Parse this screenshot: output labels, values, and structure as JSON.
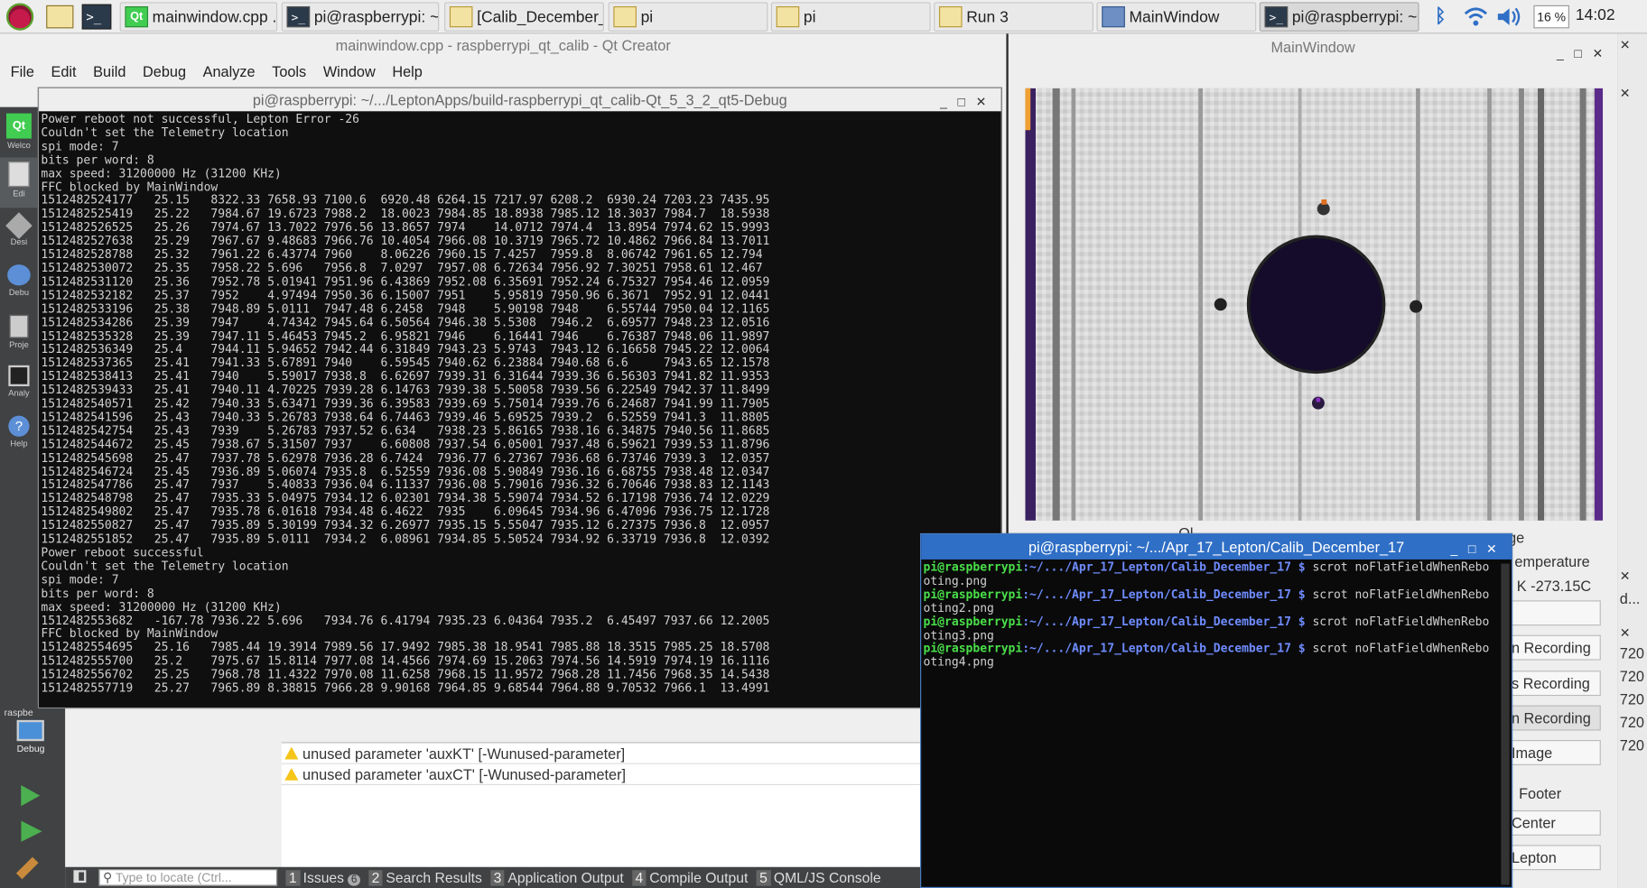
{
  "taskbar": {
    "tasks": [
      {
        "label": "mainwindow.cpp ...",
        "icon": "qt-creator-icon"
      },
      {
        "label": "pi@raspberrypi: ~...",
        "icon": "terminal-icon"
      },
      {
        "label": "[Calib_December_...",
        "icon": "folder-icon"
      },
      {
        "label": "pi",
        "icon": "folder-icon"
      },
      {
        "label": "pi",
        "icon": "folder-icon"
      },
      {
        "label": "Run 3",
        "icon": "folder-icon"
      },
      {
        "label": "MainWindow",
        "icon": "window-icon"
      },
      {
        "label": "pi@raspberrypi: ~...",
        "icon": "terminal-icon"
      }
    ],
    "cpu": "16 %",
    "clock": "14:02"
  },
  "qtcreator": {
    "title": "mainwindow.cpp - raspberrypi_qt_calib - Qt Creator",
    "menu": [
      "File",
      "Edit",
      "Build",
      "Debug",
      "Analyze",
      "Tools",
      "Window",
      "Help"
    ],
    "modes": [
      "Welco",
      "Edi",
      "Desi",
      "Debu",
      "Proje",
      "Analy",
      "Help"
    ],
    "kit": "raspbe",
    "kit_mode": "Debug",
    "issues": [
      "unused parameter 'auxKT' [-Wunused-parameter]",
      "unused parameter 'auxCT' [-Wunused-parameter]"
    ],
    "locate_placeholder": "Type to locate (Ctrl...",
    "output_tabs": [
      {
        "num": "1",
        "label": "Issues",
        "badge": "6"
      },
      {
        "num": "2",
        "label": "Search Results"
      },
      {
        "num": "3",
        "label": "Application Output"
      },
      {
        "num": "4",
        "label": "Compile Output"
      },
      {
        "num": "5",
        "label": "QML/JS Console"
      }
    ]
  },
  "term1": {
    "title": "pi@raspberrypi: ~/.../LeptonApps/build-raspberrypi_qt_calib-Qt_5_3_2_qt5-Debug",
    "lines": [
      "Power reboot not successful, Lepton Error -26",
      "Couldn't set the Telemetry location",
      "spi mode: 7",
      "bits per word: 8",
      "max speed: 31200000 Hz (31200 KHz)",
      "FFC blocked by MainWindow",
      "1512482524177   25.15   8322.33 7658.93 7100.6  6920.48 6264.15 7217.97 6208.2  6930.24 7203.23 7435.95",
      "1512482525419   25.22   7984.67 19.6723 7988.2  18.0023 7984.85 18.8938 7985.12 18.3037 7984.7  18.5938",
      "1512482526525   25.26   7974.67 13.7022 7976.56 13.8657 7974    14.0712 7974.4  13.8954 7974.62 15.9993",
      "1512482527638   25.29   7967.67 9.48683 7966.76 10.4054 7966.08 10.3719 7965.72 10.4862 7966.84 13.7011",
      "1512482528788   25.32   7961.22 6.43774 7960    8.06226 7960.15 7.4257  7959.8  8.06742 7961.65 12.794",
      "1512482530072   25.35   7958.22 5.696   7956.8  7.0297  7957.08 6.72634 7956.92 7.30251 7958.61 12.467",
      "1512482531120   25.36   7952.78 5.01941 7951.96 6.43869 7952.08 6.35691 7952.24 6.75327 7954.46 12.0959",
      "1512482532182   25.37   7952    4.97494 7950.36 6.15007 7951    5.95819 7950.96 6.3671  7952.91 12.0441",
      "1512482533196   25.38   7948.89 5.0111  7947.48 6.2458  7948    5.90198 7948    6.55744 7950.04 12.1165",
      "1512482534286   25.39   7947    4.74342 7945.64 6.50564 7946.38 5.5308  7946.2  6.69577 7948.23 12.0516",
      "1512482535328   25.39   7947.11 5.46453 7945.2  6.95821 7946    6.16441 7946    6.76387 7948.06 11.9897",
      "1512482536349   25.4    7944.11 5.94652 7942.44 6.31849 7943.23 5.9743  7943.12 6.16658 7945.22 12.0064",
      "1512482537365   25.41   7941.33 5.67891 7940    6.59545 7940.62 6.23884 7940.68 6.6     7943.65 12.1578",
      "1512482538413   25.41   7940    5.59017 7938.8  6.62697 7939.31 6.31644 7939.36 6.56303 7941.82 11.9353",
      "1512482539433   25.41   7940.11 4.70225 7939.28 6.14763 7939.38 5.50058 7939.56 6.22549 7942.37 11.8499",
      "1512482540571   25.42   7940.33 5.63471 7939.36 6.39583 7939.69 5.75014 7939.76 6.24687 7941.99 11.7905",
      "1512482541596   25.43   7940.33 5.26783 7938.64 6.74463 7939.46 5.69525 7939.2  6.52559 7941.3  11.8805",
      "1512482542754   25.43   7939    5.26783 7937.52 6.634   7938.23 5.86165 7938.16 6.34875 7940.56 11.8685",
      "1512482544672   25.45   7938.67 5.31507 7937    6.60808 7937.54 6.05001 7937.48 6.59621 7939.53 11.8796",
      "1512482545698   25.47   7937.78 5.62978 7936.28 6.7424  7936.77 6.27367 7936.68 6.73746 7939.3  12.0357",
      "1512482546724   25.45   7936.89 5.06074 7935.8  6.52559 7936.08 5.90849 7936.16 6.68755 7938.48 12.0347",
      "1512482547786   25.47   7937    5.40833 7936.04 6.11337 7936.08 5.79016 7936.32 6.70646 7938.83 12.1143",
      "1512482548798   25.47   7935.33 5.04975 7934.12 6.02301 7934.38 5.59074 7934.52 6.17198 7936.74 12.0229",
      "1512482549802   25.47   7935.78 6.01618 7934.48 6.4622  7935    6.09645 7934.96 6.47096 7936.75 12.1728",
      "1512482550827   25.47   7935.89 5.30199 7934.32 6.26977 7935.15 5.55047 7935.12 6.27375 7936.8  12.0957",
      "1512482551852   25.47   7935.89 5.0111  7934.2  6.08961 7934.85 5.50524 7934.92 6.33719 7936.8  12.0392",
      "Power reboot successful",
      "Couldn't set the Telemetry location",
      "spi mode: 7",
      "bits per word: 8",
      "max speed: 31200000 Hz (31200 KHz)",
      "1512482553682   -167.78 7936.22 5.696   7934.76 6.41794 7935.23 6.04364 7935.2  6.45497 7937.66 12.2005",
      "FFC blocked by MainWindow",
      "1512482554695   25.16   7985.44 19.3914 7989.56 17.9492 7985.38 18.9541 7985.88 18.3515 7985.25 18.5708",
      "1512482555700   25.2    7975.67 15.8114 7977.08 14.4566 7974.69 15.2063 7974.56 14.5919 7974.19 16.1116",
      "1512482556702   25.25   7968.78 11.4322 7970.08 11.6258 7968.15 11.9572 7968.28 11.7456 7968.35 14.5438",
      "1512482557719   25.27   7965.89 8.38815 7966.28 9.90168 7964.85 9.68544 7964.88 9.70532 7966.1  13.4991"
    ]
  },
  "mainwindow": {
    "title": "MainWindow",
    "labels": [
      "Ol...",
      "...ge",
      "emperature",
      "K -273.15C"
    ],
    "buttons": [
      "n Recording",
      "s Recording",
      "n Recording",
      "Image",
      "Footer",
      "Center",
      "Lepton"
    ]
  },
  "term2": {
    "title": "pi@raspberrypi: ~/.../Apr_17_Lepton/Calib_December_17",
    "prompt_user": "pi@raspberrypi",
    "prompt_path": ":~/.../Apr_17_Lepton/Calib_December_17 $",
    "entries": [
      {
        "cmd": " scrot noFlatFieldWhenRebo",
        "wrap": "oting.png"
      },
      {
        "cmd": " scrot noFlatFieldWhenRebo",
        "wrap": "oting2.png"
      },
      {
        "cmd": " scrot noFlatFieldWhenRebo",
        "wrap": "oting3.png"
      },
      {
        "cmd": " scrot noFlatFieldWhenRebo",
        "wrap": "oting4.png"
      }
    ]
  },
  "rightstrip": {
    "texts": [
      "d...",
      "720",
      "720",
      "720",
      "720",
      "720"
    ]
  }
}
